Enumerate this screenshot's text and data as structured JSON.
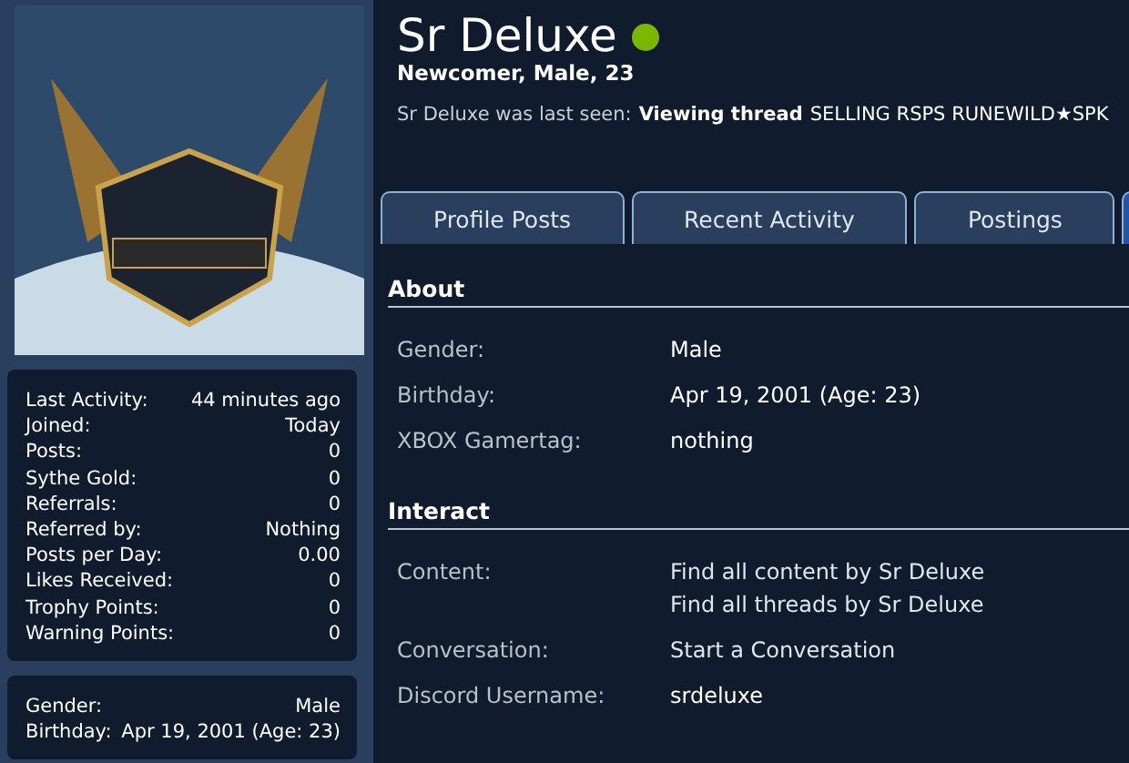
{
  "profile": {
    "name": "Sr Deluxe",
    "online": true,
    "subtitle": "Newcomer, Male, 23",
    "last_seen": {
      "label": "Sr Deluxe was last seen:",
      "action": "Viewing thread",
      "thread": "SELLING RSPS RUNEWILD★SPK"
    }
  },
  "sidebar": {
    "stats": [
      {
        "label": "Last Activity:",
        "value": "44 minutes ago"
      },
      {
        "label": "Joined:",
        "value": "Today"
      },
      {
        "label": "Posts:",
        "value": "0"
      },
      {
        "label": "Sythe Gold:",
        "value": "0"
      },
      {
        "label": "Referrals:",
        "value": "0"
      },
      {
        "label": "Referred by:",
        "value": "Nothing"
      },
      {
        "label": "Posts per Day:",
        "value": "0.00"
      },
      {
        "label": "Likes Received:",
        "value": "0"
      },
      {
        "label": "Trophy Points:",
        "value": "0"
      },
      {
        "label": "Warning Points:",
        "value": "0"
      }
    ],
    "info": [
      {
        "label": "Gender:",
        "value": "Male"
      },
      {
        "label": "Birthday:",
        "value": "Apr 19, 2001 (Age: 23)"
      }
    ]
  },
  "tabs": [
    {
      "label": "Profile Posts",
      "selected": false
    },
    {
      "label": "Recent Activity",
      "selected": false
    },
    {
      "label": "Postings",
      "selected": false
    },
    {
      "selected": true
    }
  ],
  "sections": [
    {
      "title": "About",
      "rows": [
        {
          "label": "Gender:",
          "values": [
            {
              "text": "Male",
              "kind": "text"
            }
          ]
        },
        {
          "label": "Birthday:",
          "values": [
            {
              "text": "Apr 19, 2001 (Age: 23)",
              "kind": "text"
            }
          ]
        },
        {
          "label": "XBOX Gamertag:",
          "values": [
            {
              "text": "nothing",
              "kind": "text"
            }
          ]
        }
      ]
    },
    {
      "title": "Interact",
      "rows": [
        {
          "label": "Content:",
          "values": [
            {
              "text": "Find all content by Sr Deluxe",
              "kind": "link"
            },
            {
              "text": "Find all threads by Sr Deluxe",
              "kind": "link"
            }
          ]
        },
        {
          "label": "Conversation:",
          "values": [
            {
              "text": "Start a Conversation",
              "kind": "link"
            }
          ]
        },
        {
          "label": "Discord Username:",
          "values": [
            {
              "text": "srdeluxe",
              "kind": "text"
            }
          ]
        }
      ]
    }
  ]
}
